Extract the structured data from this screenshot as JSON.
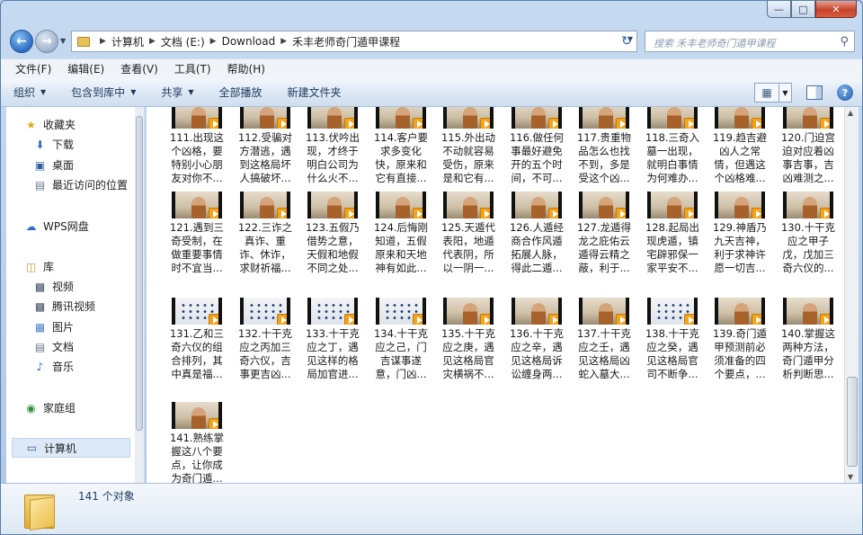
{
  "window": {
    "title": "禾丰老师奇门遁甲课程",
    "caption_min": "—",
    "caption_max": "□",
    "caption_close": "✕"
  },
  "address": {
    "crumbs": [
      "计算机",
      "文档 (E:)",
      "Download",
      "禾丰老师奇门遁甲课程"
    ],
    "search_placeholder": "搜索 禾丰老师奇门遁甲课程"
  },
  "menu": [
    "文件(F)",
    "编辑(E)",
    "查看(V)",
    "工具(T)",
    "帮助(H)"
  ],
  "toolbar": {
    "organize": "组织",
    "include_in_library": "包含到库中",
    "share": "共享",
    "play_all": "全部播放",
    "new_folder": "新建文件夹",
    "help": "?"
  },
  "nav": {
    "favorites": "收藏夹",
    "downloads": "下载",
    "desktop": "桌面",
    "recent": "最近访问的位置",
    "wps": "WPS网盘",
    "libraries": "库",
    "videos": "视频",
    "tencent_video": "腾讯视频",
    "pictures": "图片",
    "documents": "文档",
    "music": "音乐",
    "homegroup": "家庭组",
    "computer": "计算机"
  },
  "files": [
    {
      "lines": [
        "111.出现这",
        "个凶格，要",
        "特别小心朋",
        "友对你不..."
      ],
      "thumb": "person"
    },
    {
      "lines": [
        "112.受骗对",
        "方潜逃，遇",
        "到这格局坏",
        "人搞破坏..."
      ],
      "thumb": "person"
    },
    {
      "lines": [
        "113.伏吟出",
        "现，才终于",
        "明白公司为",
        "什么火不..."
      ],
      "thumb": "person"
    },
    {
      "lines": [
        "114.客户要",
        "求多变化",
        "快，原来和",
        "它有直接..."
      ],
      "thumb": "person"
    },
    {
      "lines": [
        "115.外出动",
        "不动就容易",
        "受伤，原来",
        "是和它有..."
      ],
      "thumb": "person"
    },
    {
      "lines": [
        "116.做任何",
        "事最好避免",
        "开的五个时",
        "间，不可..."
      ],
      "thumb": "person"
    },
    {
      "lines": [
        "117.贵重物",
        "品怎么也找",
        "不到，多是",
        "受这个凶..."
      ],
      "thumb": "person"
    },
    {
      "lines": [
        "118.三奇入",
        "墓一出现，",
        "就明白事情",
        "为何难办..."
      ],
      "thumb": "person"
    },
    {
      "lines": [
        "119.趋吉避",
        "凶人之常",
        "情，但遇这",
        "个凶格难..."
      ],
      "thumb": "person"
    },
    {
      "lines": [
        "120.门迫宫",
        "迫对应着凶",
        "事吉事，吉",
        "凶难测之..."
      ],
      "thumb": "person"
    },
    {
      "lines": [
        "121.遇到三",
        "奇受制，在",
        "做重要事情",
        "时不宜当..."
      ],
      "thumb": "person"
    },
    {
      "lines": [
        "122.三诈之",
        "真诈、重",
        "诈、休诈，",
        "求财祈福..."
      ],
      "thumb": "person"
    },
    {
      "lines": [
        "123.五假乃",
        "借势之意，",
        "天假和地假",
        "不同之处..."
      ],
      "thumb": "person"
    },
    {
      "lines": [
        "124.后悔刚",
        "知道，五假",
        "原来和天地",
        "神有如此..."
      ],
      "thumb": "person"
    },
    {
      "lines": [
        "125.天遁代",
        "表阳，地遁",
        "代表阴，所",
        "以一阴一..."
      ],
      "thumb": "person"
    },
    {
      "lines": [
        "126.人遁经",
        "商合作风遁",
        "拓展人脉，",
        "得此二遁..."
      ],
      "thumb": "person"
    },
    {
      "lines": [
        "127.龙遁得",
        "龙之庇佑云",
        "遁得云精之",
        "蔽，利于..."
      ],
      "thumb": "person"
    },
    {
      "lines": [
        "128.起局出",
        "现虎遁，镇",
        "宅辟邪保一",
        "家平安不..."
      ],
      "thumb": "person"
    },
    {
      "lines": [
        "129.神盾乃",
        "九天吉神，",
        "利于求神许",
        "愿一切吉..."
      ],
      "thumb": "person"
    },
    {
      "lines": [
        "130.十干克",
        "应之甲子",
        "戊，戊加三",
        "奇六仪的..."
      ],
      "thumb": "person"
    },
    {
      "lines": [
        "131.乙和三",
        "奇六仪的组",
        "合排列，其",
        "中真是福..."
      ],
      "thumb": "board"
    },
    {
      "lines": [
        "132.十干克",
        "应之丙加三",
        "奇六仪，吉",
        "事更吉凶..."
      ],
      "thumb": "board"
    },
    {
      "lines": [
        "133.十干克",
        "应之丁，遇",
        "见这样的格",
        "局加官进..."
      ],
      "thumb": "board"
    },
    {
      "lines": [
        "134.十干克",
        "应之己，门",
        "吉谋事遂",
        "意，门凶..."
      ],
      "thumb": "board"
    },
    {
      "lines": [
        "135.十干克",
        "应之庚，遇",
        "见这格局官",
        "灾横祸不..."
      ],
      "thumb": "person"
    },
    {
      "lines": [
        "136.十干克",
        "应之辛，遇",
        "见这格局诉",
        "讼缠身两..."
      ],
      "thumb": "person"
    },
    {
      "lines": [
        "137.十干克",
        "应之壬，遇",
        "见这格局凶",
        "蛇入墓大..."
      ],
      "thumb": "person"
    },
    {
      "lines": [
        "138.十干克",
        "应之癸，遇",
        "见这格局官",
        "司不断争..."
      ],
      "thumb": "board"
    },
    {
      "lines": [
        "139.奇门遁",
        "甲预测前必",
        "须准备的四",
        "个要点，..."
      ],
      "thumb": "person"
    },
    {
      "lines": [
        "140.掌握这",
        "两种方法，",
        "奇门遁甲分",
        "析判断思..."
      ],
      "thumb": "person"
    },
    {
      "lines": [
        "141.熟练掌",
        "握这八个要",
        "点，让你成",
        "为奇门遁..."
      ],
      "thumb": "person"
    }
  ],
  "status": {
    "count": "141 个对象"
  }
}
